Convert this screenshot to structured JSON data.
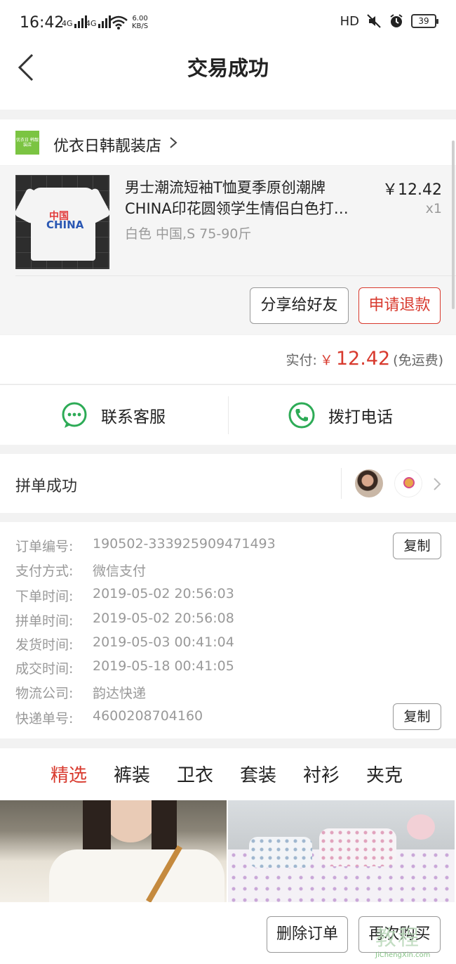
{
  "status_bar": {
    "time": "16:42",
    "signal1": "4G",
    "signal2": "4G",
    "speed_value": "6.00",
    "speed_unit": "KB/S",
    "hd": "HD",
    "battery": "39"
  },
  "nav": {
    "title": "交易成功"
  },
  "shop": {
    "name": "优衣日韩靓装店",
    "logo_text": "优衣日 韩靓装店"
  },
  "product": {
    "title_line1": "男士潮流短袖T恤夏季原创潮牌",
    "title_line2": "CHINA印花圆领学生情侣白色打…",
    "spec": "白色 中国,S 75-90斤",
    "price": "￥12.42",
    "qty": "x1",
    "print_top": "中国",
    "print_bottom": "CHINA"
  },
  "actions": {
    "share": "分享给好友",
    "refund": "申请退款"
  },
  "payment": {
    "label": "实付:",
    "currency": "￥",
    "amount": "12.42",
    "note": "(免运费)"
  },
  "contact": {
    "service": "联系客服",
    "phone": "拨打电话"
  },
  "group": {
    "label": "拼单成功"
  },
  "order_info": {
    "copy_label": "复制",
    "rows": [
      {
        "key": "订单编号:",
        "value": "190502-333925909471493"
      },
      {
        "key": "支付方式:",
        "value": "微信支付"
      },
      {
        "key": "下单时间:",
        "value": "2019-05-02 20:56:03"
      },
      {
        "key": "拼单时间:",
        "value": "2019-05-02 20:56:08"
      },
      {
        "key": "发货时间:",
        "value": "2019-05-03 00:41:04"
      },
      {
        "key": "成交时间:",
        "value": "2019-05-18 00:41:05"
      },
      {
        "key": "物流公司:",
        "value": "韵达快递"
      },
      {
        "key": "快递单号:",
        "value": "4600208704160"
      }
    ]
  },
  "tabs": [
    "精选",
    "裤装",
    "卫衣",
    "套装",
    "衬衫",
    "夹克"
  ],
  "footer": {
    "delete": "删除订单",
    "buy_again": "再次购买"
  },
  "watermark": {
    "big": "教程",
    "small": "JiChengXin.com"
  },
  "colors": {
    "accent": "#d83a2e",
    "wechat_green": "#2dab56",
    "shop_green": "#7bc442"
  }
}
